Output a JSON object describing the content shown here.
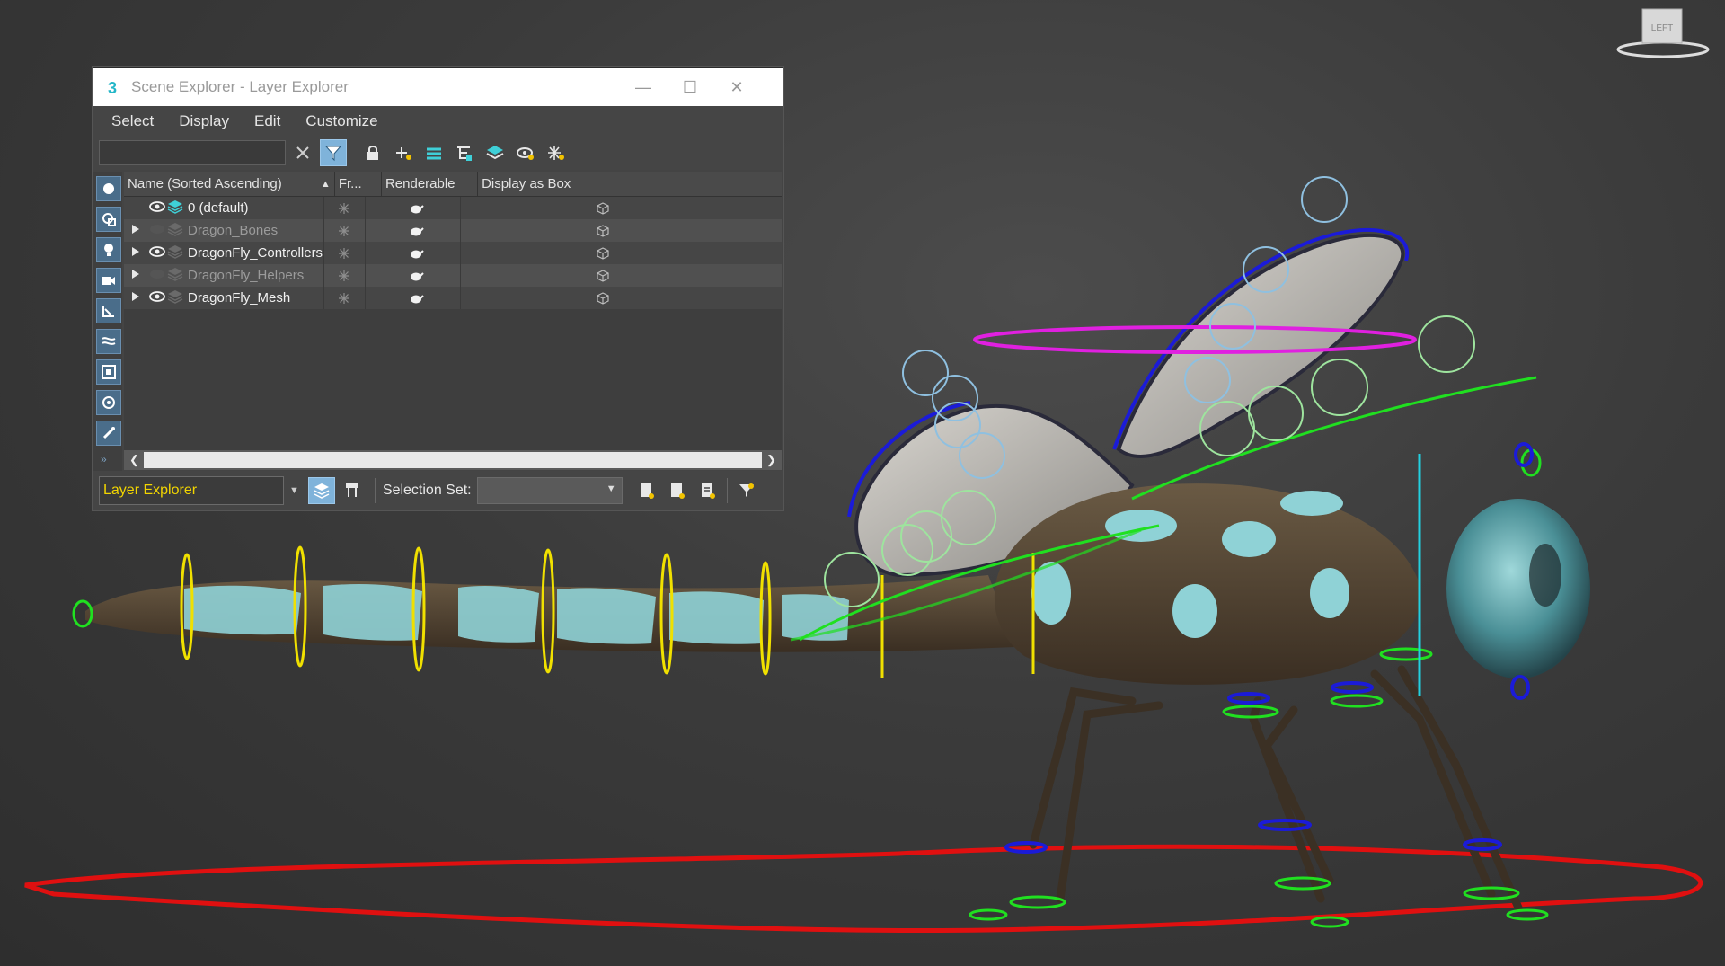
{
  "window": {
    "title": "Scene Explorer - Layer Explorer",
    "menu": [
      "Select",
      "Display",
      "Edit",
      "Customize"
    ]
  },
  "columns": {
    "name": "Name (Sorted Ascending)",
    "frozen": "Fr...",
    "renderable": "Renderable",
    "display_as_box": "Display as Box"
  },
  "layers": [
    {
      "name": "0 (default)",
      "visible": true,
      "expandable": false
    },
    {
      "name": "Dragon_Bones",
      "visible": false,
      "expandable": true
    },
    {
      "name": "DragonFly_Controllers",
      "visible": true,
      "expandable": true
    },
    {
      "name": "DragonFly_Helpers",
      "visible": false,
      "expandable": true
    },
    {
      "name": "DragonFly_Mesh",
      "visible": true,
      "expandable": true
    }
  ],
  "bottom": {
    "explorer_type": "Layer Explorer",
    "selection_set_label": "Selection Set:",
    "selection_set_value": ""
  },
  "viewcube": {
    "label": "LEFT"
  },
  "colors": {
    "accent": "#7fb3da",
    "active_explorer_text": "#f2d500",
    "layer_icon": "#3fd0d8",
    "path_red": "#e01010",
    "controller_yellow": "#f0e000",
    "controller_green": "#20e020",
    "controller_blue": "#1b1bd8",
    "controller_magenta": "#e020e0"
  },
  "icons": {
    "toolbar": [
      "clear-search-icon",
      "filter-icon",
      "lock-icon",
      "new-layer-icon",
      "add-to-layer-icon",
      "layer-hierarchy-icon",
      "layers-icon",
      "hide-icon",
      "freeze-icon"
    ],
    "left_strip": [
      "geometry-filter-icon",
      "shapes-filter-icon",
      "lights-filter-icon",
      "cameras-filter-icon",
      "helpers-filter-icon",
      "spacewarps-filter-icon",
      "groups-filter-icon",
      "xrefs-filter-icon",
      "bones-filter-icon"
    ]
  }
}
